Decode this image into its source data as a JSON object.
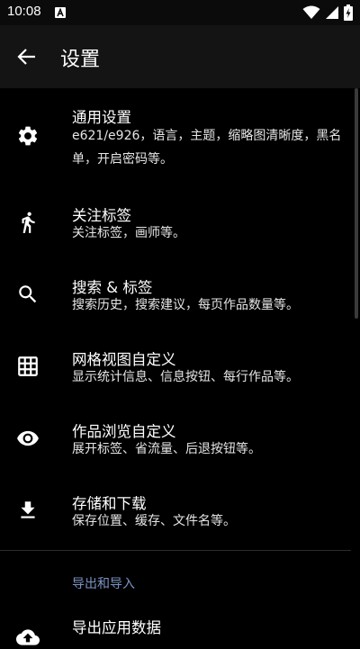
{
  "status_bar": {
    "time": "10:08"
  },
  "app_bar": {
    "title": "设置"
  },
  "settings": [
    {
      "icon": "gear-icon",
      "title": "通用设置",
      "subtitle": "e621/e926，语言，主题，缩略图清晰度，黑名单，开启密码等。"
    },
    {
      "icon": "walk-icon",
      "title": "关注标签",
      "subtitle": "关注标签，画师等。"
    },
    {
      "icon": "search-icon",
      "title": "搜索 & 标签",
      "subtitle": "搜索历史，搜索建议，每页作品数量等。"
    },
    {
      "icon": "grid-icon",
      "title": "网格视图自定义",
      "subtitle": "显示统计信息、信息按钮、每行作品等。"
    },
    {
      "icon": "eye-icon",
      "title": "作品浏览自定义",
      "subtitle": "展开标签、省流量、后退按钮等。"
    },
    {
      "icon": "download-icon",
      "title": "存储和下载",
      "subtitle": "保存位置、缓存、文件名等。"
    }
  ],
  "section": {
    "header": "导出和导入"
  },
  "export_item": {
    "icon": "cloud-upload-icon",
    "title": "导出应用数据"
  },
  "colors": {
    "background": "#000000",
    "app_bar": "#141414",
    "section_header": "#7b95c7"
  }
}
